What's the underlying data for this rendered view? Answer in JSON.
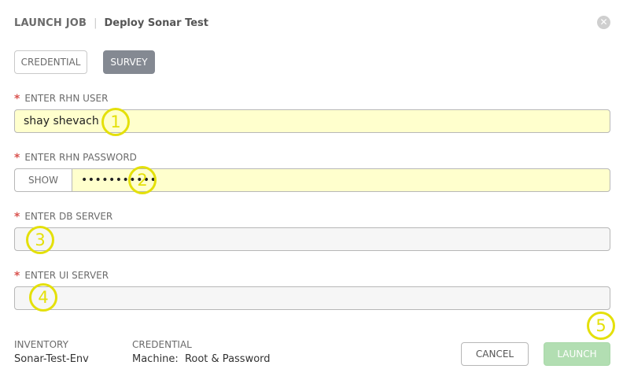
{
  "header": {
    "title": "LAUNCH JOB",
    "separator": "|",
    "job_name": "Deploy Sonar Test",
    "close_glyph": "✕"
  },
  "tabs": [
    {
      "label": "CREDENTIAL",
      "active": false
    },
    {
      "label": "SURVEY",
      "active": true
    }
  ],
  "fields": {
    "rhn_user": {
      "label": "ENTER RHN USER",
      "required_mark": "*",
      "value": "shay shevach"
    },
    "rhn_password": {
      "label": "ENTER RHN PASSWORD",
      "required_mark": "*",
      "show_label": "SHOW",
      "value": "•••••••••••"
    },
    "db_server": {
      "label": "ENTER DB SERVER",
      "required_mark": "*",
      "value": ""
    },
    "ui_server": {
      "label": "ENTER UI SERVER",
      "required_mark": "*",
      "value": ""
    }
  },
  "markers": [
    "1",
    "2",
    "3",
    "4",
    "5"
  ],
  "footer": {
    "inventory_label": "INVENTORY",
    "inventory_value": "Sonar-Test-Env",
    "credential_label": "CREDENTIAL",
    "machine_label": "Machine:",
    "machine_value": "Root & Password",
    "cancel_label": "CANCEL",
    "launch_label": "LAUNCH"
  },
  "colors": {
    "required": "#d9534f",
    "filled_bg": "#ffffcd",
    "marker": "#e4e00a",
    "launch_disabled": "#b2deb2",
    "active_tab": "#848992"
  }
}
